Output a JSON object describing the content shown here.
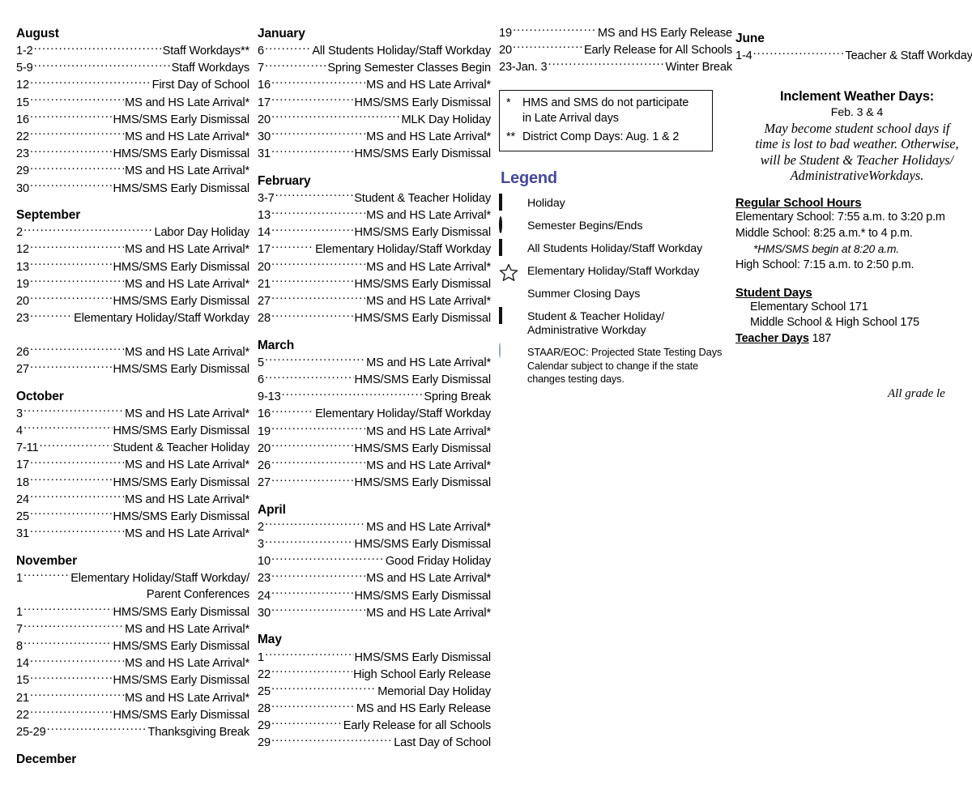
{
  "columns": {
    "col1": {
      "months": [
        {
          "name": "August",
          "events": [
            {
              "date": "1-2",
              "text": "Staff Workdays**"
            },
            {
              "date": "5-9",
              "text": "Staff Workdays"
            },
            {
              "date": "12",
              "text": "First Day of School"
            },
            {
              "date": "15",
              "text": "MS and HS Late Arrival*"
            },
            {
              "date": "16",
              "text": "HMS/SMS Early Dismissal"
            },
            {
              "date": "22",
              "text": "MS and HS Late Arrival*"
            },
            {
              "date": "23",
              "text": "HMS/SMS Early Dismissal"
            },
            {
              "date": "29",
              "text": "MS and HS Late Arrival*"
            },
            {
              "date": "30",
              "text": "HMS/SMS Early Dismissal"
            }
          ]
        },
        {
          "name": "September",
          "events": [
            {
              "date": "2",
              "text": "Labor Day Holiday"
            },
            {
              "date": "12",
              "text": "MS and HS Late Arrival*"
            },
            {
              "date": "13",
              "text": "HMS/SMS Early Dismissal"
            },
            {
              "date": "19",
              "text": "MS and HS Late Arrival*"
            },
            {
              "date": "20",
              "text": "HMS/SMS Early Dismissal"
            },
            {
              "date": "23",
              "text": "Elementary Holiday/Staff Workday"
            },
            {
              "spacer": true
            },
            {
              "date": "26",
              "text": "MS and HS Late Arrival*"
            },
            {
              "date": "27",
              "text": "HMS/SMS Early Dismissal"
            }
          ]
        },
        {
          "name": "October",
          "events": [
            {
              "date": "3",
              "text": "MS and HS Late Arrival*"
            },
            {
              "date": "4",
              "text": "HMS/SMS Early Dismissal"
            },
            {
              "date": "7-11",
              "text": "Student & Teacher Holiday"
            },
            {
              "date": "17",
              "text": "MS and HS Late Arrival*"
            },
            {
              "date": "18",
              "text": "HMS/SMS Early Dismissal"
            },
            {
              "date": "24",
              "text": "MS and HS Late Arrival*"
            },
            {
              "date": "25",
              "text": "HMS/SMS Early Dismissal"
            },
            {
              "date": "31",
              "text": "MS and HS Late Arrival*"
            }
          ]
        },
        {
          "name": "November",
          "events": [
            {
              "date": "1",
              "text": "Elementary Holiday/Staff Workday/",
              "text2": "Parent Conferences",
              "wrap": true
            },
            {
              "date": "1",
              "text": "HMS/SMS Early Dismissal"
            },
            {
              "date": "7",
              "text": "MS and HS Late Arrival*"
            },
            {
              "date": "8",
              "text": "HMS/SMS Early Dismissal"
            },
            {
              "date": "14",
              "text": "MS and HS Late Arrival*"
            },
            {
              "date": "15",
              "text": "HMS/SMS Early Dismissal"
            },
            {
              "date": "21",
              "text": "MS and HS Late Arrival*"
            },
            {
              "date": "22",
              "text": "HMS/SMS Early Dismissal"
            },
            {
              "date": "25-29",
              "text": "Thanksgiving Break"
            }
          ]
        },
        {
          "name": "December",
          "events": []
        }
      ]
    },
    "col2": {
      "months": [
        {
          "name": "January",
          "events": [
            {
              "date": "6",
              "text": "All Students Holiday/Staff Workday"
            },
            {
              "date": "7",
              "text": "Spring Semester Classes Begin"
            },
            {
              "date": "16",
              "text": "MS and HS Late Arrival*"
            },
            {
              "date": "17",
              "text": "HMS/SMS Early Dismissal"
            },
            {
              "date": "20",
              "text": "MLK Day Holiday"
            },
            {
              "date": "30",
              "text": "MS and HS Late Arrival*"
            },
            {
              "date": "31",
              "text": "HMS/SMS Early Dismissal"
            }
          ]
        },
        {
          "name": "February",
          "events": [
            {
              "date": "3-7",
              "text": "Student & Teacher Holiday"
            },
            {
              "date": "13",
              "text": "MS and HS Late Arrival*"
            },
            {
              "date": "14",
              "text": "HMS/SMS Early Dismissal"
            },
            {
              "date": "17",
              "text": "Elementary Holiday/Staff Workday"
            },
            {
              "date": "20",
              "text": "MS and HS Late Arrival*"
            },
            {
              "date": "21",
              "text": "HMS/SMS Early Dismissal"
            },
            {
              "date": "27",
              "text": "MS and HS Late Arrival*"
            },
            {
              "date": "28",
              "text": "HMS/SMS Early Dismissal"
            }
          ]
        },
        {
          "name": "March",
          "events": [
            {
              "date": "5",
              "text": "MS and HS Late Arrival*"
            },
            {
              "date": "6",
              "text": "HMS/SMS Early Dismissal"
            },
            {
              "date": "9-13",
              "text": "Spring Break"
            },
            {
              "date": "16",
              "text": "Elementary Holiday/Staff Workday"
            },
            {
              "date": "19",
              "text": "MS and HS Late Arrival*"
            },
            {
              "date": "20",
              "text": "HMS/SMS Early Dismissal"
            },
            {
              "date": "26",
              "text": "MS and HS Late Arrival*"
            },
            {
              "date": "27",
              "text": "HMS/SMS Early Dismissal"
            }
          ]
        },
        {
          "name": "April",
          "events": [
            {
              "date": "2",
              "text": "MS and HS Late Arrival*"
            },
            {
              "date": "3",
              "text": "HMS/SMS Early Dismissal"
            },
            {
              "date": "10",
              "text": "Good Friday Holiday"
            },
            {
              "date": "23",
              "text": "MS and HS Late Arrival*"
            },
            {
              "date": "24",
              "text": "HMS/SMS Early Dismissal"
            },
            {
              "date": "30",
              "text": "MS and HS Late Arrival*"
            }
          ]
        },
        {
          "name": "May",
          "events": [
            {
              "date": "1",
              "text": "HMS/SMS Early Dismissal"
            },
            {
              "date": "22",
              "text": "High School Early Release"
            },
            {
              "date": "25",
              "text": "Memorial Day Holiday"
            },
            {
              "date": "28",
              "text": "MS and HS Early Release"
            },
            {
              "date": "29",
              "text": "Early Release for all Schools"
            },
            {
              "date": "29",
              "text": "Last Day of School"
            }
          ]
        }
      ]
    },
    "col3": {
      "december_continued": [
        {
          "date": "19",
          "text": "MS and HS Early Release"
        },
        {
          "date": "20",
          "text": "Early Release for All Schools"
        },
        {
          "date": "23-Jan. 3",
          "text": "Winter Break"
        }
      ],
      "notes": {
        "single_star_mark": "*",
        "single_star_line1": "HMS and SMS do not participate",
        "single_star_line2": "in Late Arrival days",
        "double_star_mark": "**",
        "double_star_line1": "District Comp Days: Aug. 1 & 2"
      },
      "legend": {
        "title": "Legend",
        "items": [
          {
            "swatch": "orange-square",
            "label": "Holiday"
          },
          {
            "swatch": "blue-circle",
            "label": "Semester Begins/Ends"
          },
          {
            "swatch": "diagonal-square",
            "label": "All Students Holiday/Staff Workday"
          },
          {
            "swatch": "star-outline",
            "label": "Elementary Holiday/Staff Workday"
          },
          {
            "swatch": "yellow-square",
            "label": "Summer Closing Days"
          },
          {
            "swatch": "green-square",
            "label": "Student & Teacher Holiday/",
            "label2": "Administrative Workday"
          },
          {
            "swatch": "lightblue-circle",
            "label": "STAAR/EOC: Projected State Testing Days"
          }
        ],
        "footnote": "Calendar subject to change if the state changes testing days."
      }
    },
    "col4": {
      "june": {
        "name": "June",
        "events": [
          {
            "date": "1-4",
            "text": "Teacher & Staff Workdays"
          }
        ]
      },
      "inclement": {
        "heading": "Inclement Weather Days:",
        "dates": "Feb. 3 & 4",
        "note_line1": "May become student school days if",
        "note_line2": "time is lost to bad weather. Otherwise,",
        "note_line3": "will be Student & Teacher Holidays/",
        "note_line4": "AdministrativeWorkdays."
      },
      "school_hours": {
        "heading": "Regular School Hours",
        "elementary": "Elementary School: 7:55 a.m. to 3:20 p.m",
        "middle": "Middle School: 8:25 a.m.* to 4 p.m.",
        "middle_note": "*HMS/SMS begin at 8:20 a.m.",
        "high": "High School: 7:15 a.m. to 2:50 p.m."
      },
      "student_days": {
        "heading": "Student Days",
        "elementary": "Elementary School 171",
        "secondary": "Middle School & High School 175",
        "teacher_heading": "Teacher Days",
        "teacher_value": "187"
      }
    }
  },
  "grade_note": "All grade le",
  "colors": {
    "legend_title": "#44489f",
    "holiday_orange": "#ff9900",
    "semester_blue": "#3399dd",
    "diagonal_cream": "#fdf3c4",
    "summer_yellow": "#fff200",
    "teacher_green": "#8cd79e",
    "staar_lightblue": "#cfdcf0"
  }
}
